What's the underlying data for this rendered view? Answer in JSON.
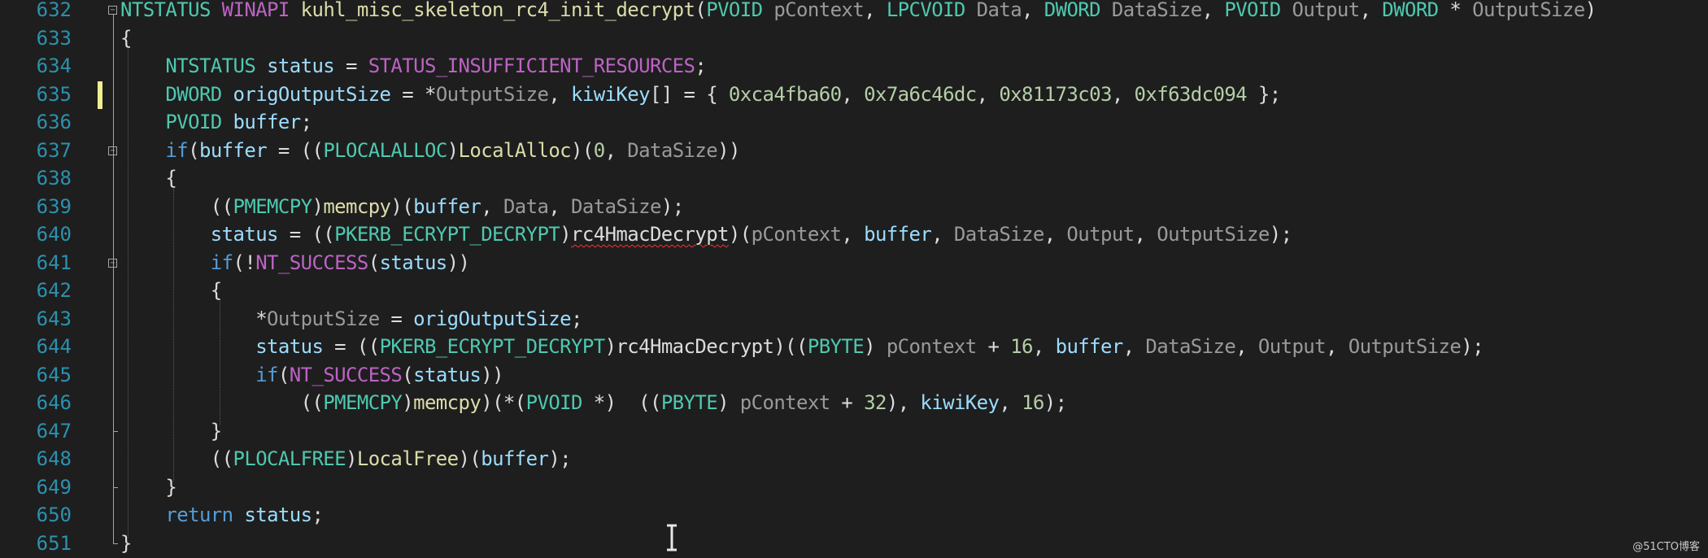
{
  "colors": {
    "background": "#1e1e1e",
    "line_number": "#2b91af",
    "keyword": "#569cd6",
    "type": "#4ec9b0",
    "macro": "#bd63c5",
    "function": "#dcdcaa",
    "variable": "#9cdcfe",
    "parameter": "#9a9a9a",
    "number": "#b5cea8",
    "plain": "#dcdcdc",
    "change_marker": "#efef91",
    "error_squiggle": "#ff3030"
  },
  "cursor": {
    "type": "ibeam-icon"
  },
  "watermark": "@51CTO博客",
  "editor": {
    "lines": [
      {
        "number": "632",
        "tokens": [
          {
            "t": "NTSTATUS",
            "c": "ty"
          },
          {
            "t": " ",
            "c": "pl"
          },
          {
            "t": "WINAPI",
            "c": "mac"
          },
          {
            "t": " ",
            "c": "pl"
          },
          {
            "t": "kuhl_misc_skeleton_rc4_init_decrypt",
            "c": "fn"
          },
          {
            "t": "(",
            "c": "pl"
          },
          {
            "t": "PVOID",
            "c": "ty"
          },
          {
            "t": " ",
            "c": "pl"
          },
          {
            "t": "pContext",
            "c": "par"
          },
          {
            "t": ", ",
            "c": "pl"
          },
          {
            "t": "LPCVOID",
            "c": "ty"
          },
          {
            "t": " ",
            "c": "pl"
          },
          {
            "t": "Data",
            "c": "par"
          },
          {
            "t": ", ",
            "c": "pl"
          },
          {
            "t": "DWORD",
            "c": "ty"
          },
          {
            "t": " ",
            "c": "pl"
          },
          {
            "t": "DataSize",
            "c": "par"
          },
          {
            "t": ", ",
            "c": "pl"
          },
          {
            "t": "PVOID",
            "c": "ty"
          },
          {
            "t": " ",
            "c": "pl"
          },
          {
            "t": "Output",
            "c": "par"
          },
          {
            "t": ", ",
            "c": "pl"
          },
          {
            "t": "DWORD",
            "c": "ty"
          },
          {
            "t": " * ",
            "c": "pl"
          },
          {
            "t": "OutputSize",
            "c": "par"
          },
          {
            "t": ")",
            "c": "pl"
          }
        ]
      },
      {
        "number": "633",
        "tokens": [
          {
            "t": "{",
            "c": "pl"
          }
        ]
      },
      {
        "number": "634",
        "tokens": [
          {
            "t": "    ",
            "c": "pl"
          },
          {
            "t": "NTSTATUS",
            "c": "ty"
          },
          {
            "t": " ",
            "c": "pl"
          },
          {
            "t": "status",
            "c": "var"
          },
          {
            "t": " = ",
            "c": "pl"
          },
          {
            "t": "STATUS_INSUFFICIENT_RESOURCES",
            "c": "mac"
          },
          {
            "t": ";",
            "c": "pl"
          }
        ]
      },
      {
        "number": "635",
        "tokens": [
          {
            "t": "    ",
            "c": "pl"
          },
          {
            "t": "DWORD",
            "c": "ty"
          },
          {
            "t": " ",
            "c": "pl"
          },
          {
            "t": "origOutputSize",
            "c": "var"
          },
          {
            "t": " = *",
            "c": "pl"
          },
          {
            "t": "OutputSize",
            "c": "par"
          },
          {
            "t": ", ",
            "c": "pl"
          },
          {
            "t": "kiwiKey",
            "c": "var"
          },
          {
            "t": "[] = { ",
            "c": "pl"
          },
          {
            "t": "0xca4fba60",
            "c": "num"
          },
          {
            "t": ", ",
            "c": "pl"
          },
          {
            "t": "0x7a6c46dc",
            "c": "num"
          },
          {
            "t": ", ",
            "c": "pl"
          },
          {
            "t": "0x81173c03",
            "c": "num"
          },
          {
            "t": ", ",
            "c": "pl"
          },
          {
            "t": "0xf63dc094",
            "c": "num"
          },
          {
            "t": " };",
            "c": "pl"
          }
        ]
      },
      {
        "number": "636",
        "tokens": [
          {
            "t": "    ",
            "c": "pl"
          },
          {
            "t": "PVOID",
            "c": "ty"
          },
          {
            "t": " ",
            "c": "pl"
          },
          {
            "t": "buffer",
            "c": "var"
          },
          {
            "t": ";",
            "c": "pl"
          }
        ]
      },
      {
        "number": "637",
        "tokens": [
          {
            "t": "    ",
            "c": "pl"
          },
          {
            "t": "if",
            "c": "kw"
          },
          {
            "t": "(",
            "c": "pl"
          },
          {
            "t": "buffer",
            "c": "var"
          },
          {
            "t": " = ((",
            "c": "pl"
          },
          {
            "t": "PLOCALALLOC",
            "c": "ty"
          },
          {
            "t": ")",
            "c": "pl"
          },
          {
            "t": "LocalAlloc",
            "c": "fn"
          },
          {
            "t": ")(",
            "c": "pl"
          },
          {
            "t": "0",
            "c": "num"
          },
          {
            "t": ", ",
            "c": "pl"
          },
          {
            "t": "DataSize",
            "c": "par"
          },
          {
            "t": "))",
            "c": "pl"
          }
        ]
      },
      {
        "number": "638",
        "tokens": [
          {
            "t": "    {",
            "c": "pl"
          }
        ]
      },
      {
        "number": "639",
        "tokens": [
          {
            "t": "        ((",
            "c": "pl"
          },
          {
            "t": "PMEMCPY",
            "c": "ty"
          },
          {
            "t": ")",
            "c": "pl"
          },
          {
            "t": "memcpy",
            "c": "fn"
          },
          {
            "t": ")(",
            "c": "pl"
          },
          {
            "t": "buffer",
            "c": "var"
          },
          {
            "t": ", ",
            "c": "pl"
          },
          {
            "t": "Data",
            "c": "par"
          },
          {
            "t": ", ",
            "c": "pl"
          },
          {
            "t": "DataSize",
            "c": "par"
          },
          {
            "t": ");",
            "c": "pl"
          }
        ]
      },
      {
        "number": "640",
        "tokens": [
          {
            "t": "        ",
            "c": "pl"
          },
          {
            "t": "status",
            "c": "var"
          },
          {
            "t": " = ((",
            "c": "pl"
          },
          {
            "t": "PKERB_ECRYPT_DECRYPT",
            "c": "ty"
          },
          {
            "t": ")",
            "c": "pl"
          },
          {
            "t": "rc4HmacDecrypt",
            "c": "pl",
            "squiggle": true
          },
          {
            "t": ")(",
            "c": "pl"
          },
          {
            "t": "pContext",
            "c": "par"
          },
          {
            "t": ", ",
            "c": "pl"
          },
          {
            "t": "buffer",
            "c": "var"
          },
          {
            "t": ", ",
            "c": "pl"
          },
          {
            "t": "DataSize",
            "c": "par"
          },
          {
            "t": ", ",
            "c": "pl"
          },
          {
            "t": "Output",
            "c": "par"
          },
          {
            "t": ", ",
            "c": "pl"
          },
          {
            "t": "OutputSize",
            "c": "par"
          },
          {
            "t": ");",
            "c": "pl"
          }
        ]
      },
      {
        "number": "641",
        "tokens": [
          {
            "t": "        ",
            "c": "pl"
          },
          {
            "t": "if",
            "c": "kw"
          },
          {
            "t": "(!",
            "c": "pl"
          },
          {
            "t": "NT_SUCCESS",
            "c": "mac"
          },
          {
            "t": "(",
            "c": "pl"
          },
          {
            "t": "status",
            "c": "var"
          },
          {
            "t": "))",
            "c": "pl"
          }
        ]
      },
      {
        "number": "642",
        "tokens": [
          {
            "t": "        {",
            "c": "pl"
          }
        ]
      },
      {
        "number": "643",
        "tokens": [
          {
            "t": "            *",
            "c": "pl"
          },
          {
            "t": "OutputSize",
            "c": "par"
          },
          {
            "t": " = ",
            "c": "pl"
          },
          {
            "t": "origOutputSize",
            "c": "var"
          },
          {
            "t": ";",
            "c": "pl"
          }
        ]
      },
      {
        "number": "644",
        "tokens": [
          {
            "t": "            ",
            "c": "pl"
          },
          {
            "t": "status",
            "c": "var"
          },
          {
            "t": " = ((",
            "c": "pl"
          },
          {
            "t": "PKERB_ECRYPT_DECRYPT",
            "c": "ty"
          },
          {
            "t": ")",
            "c": "pl"
          },
          {
            "t": "rc4HmacDecrypt",
            "c": "pl"
          },
          {
            "t": ")((",
            "c": "pl"
          },
          {
            "t": "PBYTE",
            "c": "ty"
          },
          {
            "t": ") ",
            "c": "pl"
          },
          {
            "t": "pContext",
            "c": "par"
          },
          {
            "t": " + ",
            "c": "pl"
          },
          {
            "t": "16",
            "c": "num"
          },
          {
            "t": ", ",
            "c": "pl"
          },
          {
            "t": "buffer",
            "c": "var"
          },
          {
            "t": ", ",
            "c": "pl"
          },
          {
            "t": "DataSize",
            "c": "par"
          },
          {
            "t": ", ",
            "c": "pl"
          },
          {
            "t": "Output",
            "c": "par"
          },
          {
            "t": ", ",
            "c": "pl"
          },
          {
            "t": "OutputSize",
            "c": "par"
          },
          {
            "t": ");",
            "c": "pl"
          }
        ]
      },
      {
        "number": "645",
        "tokens": [
          {
            "t": "            ",
            "c": "pl"
          },
          {
            "t": "if",
            "c": "kw"
          },
          {
            "t": "(",
            "c": "pl"
          },
          {
            "t": "NT_SUCCESS",
            "c": "mac"
          },
          {
            "t": "(",
            "c": "pl"
          },
          {
            "t": "status",
            "c": "var"
          },
          {
            "t": "))",
            "c": "pl"
          }
        ]
      },
      {
        "number": "646",
        "tokens": [
          {
            "t": "                ((",
            "c": "pl"
          },
          {
            "t": "PMEMCPY",
            "c": "ty"
          },
          {
            "t": ")",
            "c": "pl"
          },
          {
            "t": "memcpy",
            "c": "fn"
          },
          {
            "t": ")(*(",
            "c": "pl"
          },
          {
            "t": "PVOID",
            "c": "ty"
          },
          {
            "t": " *)  ((",
            "c": "pl"
          },
          {
            "t": "PBYTE",
            "c": "ty"
          },
          {
            "t": ") ",
            "c": "pl"
          },
          {
            "t": "pContext",
            "c": "par"
          },
          {
            "t": " + ",
            "c": "pl"
          },
          {
            "t": "32",
            "c": "num"
          },
          {
            "t": "), ",
            "c": "pl"
          },
          {
            "t": "kiwiKey",
            "c": "var"
          },
          {
            "t": ", ",
            "c": "pl"
          },
          {
            "t": "16",
            "c": "num"
          },
          {
            "t": ");",
            "c": "pl"
          }
        ]
      },
      {
        "number": "647",
        "tokens": [
          {
            "t": "        }",
            "c": "pl"
          }
        ]
      },
      {
        "number": "648",
        "tokens": [
          {
            "t": "        ((",
            "c": "pl"
          },
          {
            "t": "PLOCALFREE",
            "c": "ty"
          },
          {
            "t": ")",
            "c": "pl"
          },
          {
            "t": "LocalFree",
            "c": "fn"
          },
          {
            "t": ")(",
            "c": "pl"
          },
          {
            "t": "buffer",
            "c": "var"
          },
          {
            "t": ");",
            "c": "pl"
          }
        ]
      },
      {
        "number": "649",
        "tokens": [
          {
            "t": "    }",
            "c": "pl"
          }
        ]
      },
      {
        "number": "650",
        "tokens": [
          {
            "t": "    ",
            "c": "pl"
          },
          {
            "t": "return",
            "c": "kw"
          },
          {
            "t": " ",
            "c": "pl"
          },
          {
            "t": "status",
            "c": "var"
          },
          {
            "t": ";",
            "c": "pl"
          }
        ]
      },
      {
        "number": "651",
        "tokens": [
          {
            "t": "}",
            "c": "pl"
          }
        ]
      }
    ]
  }
}
